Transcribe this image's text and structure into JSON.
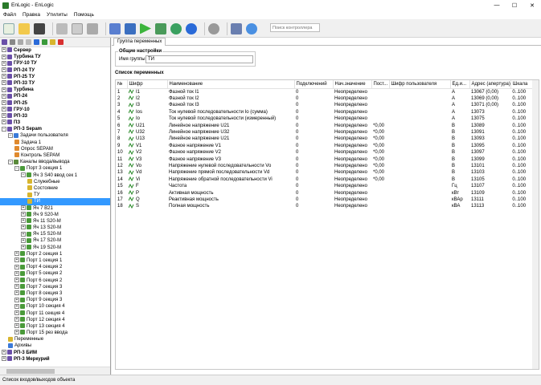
{
  "window": {
    "title": "EnLogic - EnLogic",
    "buttons": [
      "—",
      "☐",
      "✕"
    ]
  },
  "menu": [
    "Файл",
    "Правка",
    "Утилиты",
    "Помощь"
  ],
  "search": {
    "placeholder": "Поиск контроллера"
  },
  "tree": [
    {
      "label": "Сервер",
      "lvl": 0,
      "exp": "+",
      "bold": true,
      "icon": "#6a4fa8"
    },
    {
      "label": "Турбина ТУ",
      "lvl": 0,
      "exp": "+",
      "bold": true,
      "icon": "#6a4fa8"
    },
    {
      "label": "ГРУ-10 ТУ",
      "lvl": 0,
      "exp": "+",
      "bold": true,
      "icon": "#6a4fa8"
    },
    {
      "label": "РП-24 ТУ",
      "lvl": 0,
      "exp": "+",
      "bold": true,
      "icon": "#6a4fa8"
    },
    {
      "label": "РП-25 ТУ",
      "lvl": 0,
      "exp": "+",
      "bold": true,
      "icon": "#6a4fa8"
    },
    {
      "label": "РП-33 ТУ",
      "lvl": 0,
      "exp": "+",
      "bold": true,
      "icon": "#6a4fa8"
    },
    {
      "label": "Турбина",
      "lvl": 0,
      "exp": "+",
      "bold": true,
      "icon": "#6a4fa8"
    },
    {
      "label": "РП-24",
      "lvl": 0,
      "exp": "+",
      "bold": true,
      "icon": "#6a4fa8"
    },
    {
      "label": "РП-25",
      "lvl": 0,
      "exp": "+",
      "bold": true,
      "icon": "#6a4fa8"
    },
    {
      "label": "ГРУ-10",
      "lvl": 0,
      "exp": "+",
      "bold": true,
      "icon": "#6a4fa8"
    },
    {
      "label": "РП-33",
      "lvl": 0,
      "exp": "+",
      "bold": true,
      "icon": "#6a4fa8"
    },
    {
      "label": "ПЗ",
      "lvl": 0,
      "exp": "+",
      "bold": true,
      "icon": "#6a4fa8"
    },
    {
      "label": "РП-3 Sepam",
      "lvl": 0,
      "exp": "-",
      "bold": true,
      "icon": "#6a4fa8"
    },
    {
      "label": "Задачи пользователя",
      "lvl": 1,
      "exp": "-",
      "bold": false,
      "icon": "#3b7ad8"
    },
    {
      "label": "Задача 1",
      "lvl": 2,
      "exp": "",
      "bold": false,
      "icon": "#e08a2e"
    },
    {
      "label": "Опрос SEPAM",
      "lvl": 2,
      "exp": "",
      "bold": false,
      "icon": "#e08a2e"
    },
    {
      "label": "Контроль SEPAM",
      "lvl": 2,
      "exp": "",
      "bold": false,
      "icon": "#e08a2e"
    },
    {
      "label": "Каналы ввода/вывода",
      "lvl": 1,
      "exp": "-",
      "bold": false,
      "icon": "#5a8a3a"
    },
    {
      "label": "Порт 3 секция 1",
      "lvl": 2,
      "exp": "-",
      "bold": false,
      "icon": "#4a9a3a"
    },
    {
      "label": "Яч 3 S40 ввод сек 1",
      "lvl": 3,
      "exp": "-",
      "bold": false,
      "icon": "#4a9a3a"
    },
    {
      "label": "Служебные",
      "lvl": 4,
      "exp": "",
      "bold": false,
      "icon": "#d8b52e"
    },
    {
      "label": "Состояние",
      "lvl": 4,
      "exp": "",
      "bold": false,
      "icon": "#d8b52e"
    },
    {
      "label": "ТУ",
      "lvl": 4,
      "exp": "",
      "bold": false,
      "icon": "#d8b52e"
    },
    {
      "label": "ТИ",
      "lvl": 4,
      "exp": "",
      "bold": false,
      "icon": "#d8b52e",
      "sel": true
    },
    {
      "label": "Яч 7 B21",
      "lvl": 3,
      "exp": "+",
      "bold": false,
      "icon": "#4a9a3a"
    },
    {
      "label": "Яч 9 S20-M",
      "lvl": 3,
      "exp": "+",
      "bold": false,
      "icon": "#4a9a3a"
    },
    {
      "label": "Яч 11 S20-M",
      "lvl": 3,
      "exp": "+",
      "bold": false,
      "icon": "#4a9a3a"
    },
    {
      "label": "Яч 13 S20-M",
      "lvl": 3,
      "exp": "+",
      "bold": false,
      "icon": "#4a9a3a"
    },
    {
      "label": "Яч 15 S20-M",
      "lvl": 3,
      "exp": "+",
      "bold": false,
      "icon": "#4a9a3a"
    },
    {
      "label": "Яч 17 S20-M",
      "lvl": 3,
      "exp": "+",
      "bold": false,
      "icon": "#4a9a3a"
    },
    {
      "label": "Яч 19 S20-M",
      "lvl": 3,
      "exp": "+",
      "bold": false,
      "icon": "#4a9a3a"
    },
    {
      "label": "Порт 2 секция 1",
      "lvl": 2,
      "exp": "+",
      "bold": false,
      "icon": "#4a9a3a"
    },
    {
      "label": "Порт 1 секция 1",
      "lvl": 2,
      "exp": "+",
      "bold": false,
      "icon": "#4a9a3a"
    },
    {
      "label": "Порт 4 секция 2",
      "lvl": 2,
      "exp": "+",
      "bold": false,
      "icon": "#4a9a3a"
    },
    {
      "label": "Порт 5 секция 2",
      "lvl": 2,
      "exp": "+",
      "bold": false,
      "icon": "#4a9a3a"
    },
    {
      "label": "Порт 6 секция 2",
      "lvl": 2,
      "exp": "+",
      "bold": false,
      "icon": "#4a9a3a"
    },
    {
      "label": "Порт 7 секция 3",
      "lvl": 2,
      "exp": "+",
      "bold": false,
      "icon": "#4a9a3a"
    },
    {
      "label": "Порт 8 секция 3",
      "lvl": 2,
      "exp": "+",
      "bold": false,
      "icon": "#4a9a3a"
    },
    {
      "label": "Порт 9 секция 3",
      "lvl": 2,
      "exp": "+",
      "bold": false,
      "icon": "#4a9a3a"
    },
    {
      "label": "Порт 10 секция 4",
      "lvl": 2,
      "exp": "+",
      "bold": false,
      "icon": "#4a9a3a"
    },
    {
      "label": "Порт 11 секция 4",
      "lvl": 2,
      "exp": "+",
      "bold": false,
      "icon": "#4a9a3a"
    },
    {
      "label": "Порт 12 секция 4",
      "lvl": 2,
      "exp": "+",
      "bold": false,
      "icon": "#4a9a3a"
    },
    {
      "label": "Порт 13 секция 4",
      "lvl": 2,
      "exp": "+",
      "bold": false,
      "icon": "#4a9a3a"
    },
    {
      "label": "Порт 15 рез ввода",
      "lvl": 2,
      "exp": "+",
      "bold": false,
      "icon": "#4a9a3a"
    },
    {
      "label": "Переменные",
      "lvl": 1,
      "exp": "",
      "bold": false,
      "icon": "#d8b52e"
    },
    {
      "label": "Архивы",
      "lvl": 1,
      "exp": "",
      "bold": false,
      "icon": "#3b7ad8"
    },
    {
      "label": "РП-3 БИМ",
      "lvl": 0,
      "exp": "+",
      "bold": true,
      "icon": "#6a4fa8"
    },
    {
      "label": "РП-3 Меркурий",
      "lvl": 0,
      "exp": "+",
      "bold": true,
      "icon": "#6a4fa8"
    }
  ],
  "tab": "Группа переменных",
  "general": {
    "legend": "Общие настройки",
    "group_label": "Имя группы",
    "group_value": "ТИ"
  },
  "list_title": "Список переменных",
  "columns": [
    "№",
    "Шифр",
    "Наименование",
    "Подключений",
    "Нач.значение",
    "Пост...",
    "Шифр пользователя",
    "Ед.и...",
    "Адрес (апертура)",
    "Шкала"
  ],
  "rows": [
    [
      "1",
      "I1",
      "Фазной ток I1",
      "0",
      "Неопределено",
      "",
      "",
      "A",
      "13067 (0,00)",
      "0..100"
    ],
    [
      "2",
      "I2",
      "Фазной ток I2",
      "0",
      "Неопределено",
      "",
      "",
      "A",
      "13069 (0,00)",
      "0..100"
    ],
    [
      "3",
      "I3",
      "Фазной ток I3",
      "0",
      "Неопределено",
      "",
      "",
      "A",
      "13071 (0,00)",
      "0..100"
    ],
    [
      "4",
      "Ios",
      "Ток нулевой последовательности Io (сумма)",
      "0",
      "Неопределено",
      "",
      "",
      "A",
      "13073",
      "0..100"
    ],
    [
      "5",
      "Io",
      "Ток нулевой последовательности (измеренный)",
      "0",
      "Неопределено",
      "",
      "",
      "A",
      "13075",
      "0..100"
    ],
    [
      "6",
      "U21",
      "Линейное напряжение U21",
      "0",
      "Неопределено",
      "*0,00",
      "",
      "B",
      "13089",
      "0..100"
    ],
    [
      "7",
      "U32",
      "Линейное напряжение U32",
      "0",
      "Неопределено",
      "*0,00",
      "",
      "B",
      "13091",
      "0..100"
    ],
    [
      "8",
      "U13",
      "Линейное напряжение U21",
      "0",
      "Неопределено",
      "*0,00",
      "",
      "B",
      "13093",
      "0..100"
    ],
    [
      "9",
      "V1",
      "Фазное напряжение V1",
      "0",
      "Неопределено",
      "*0,00",
      "",
      "B",
      "13095",
      "0..100"
    ],
    [
      "10",
      "V2",
      "Фазное напряжение V2",
      "0",
      "Неопределено",
      "*0,00",
      "",
      "B",
      "13097",
      "0..100"
    ],
    [
      "11",
      "V3",
      "Фазное напряжение V3",
      "0",
      "Неопределено",
      "*0,00",
      "",
      "B",
      "13099",
      "0..100"
    ],
    [
      "12",
      "Vo",
      "Напряжение нулевой последовательности Vo",
      "0",
      "Неопределено",
      "*0,00",
      "",
      "B",
      "13101",
      "0..100"
    ],
    [
      "13",
      "Vd",
      "Напряжение прямой последовательности Vd",
      "0",
      "Неопределено",
      "*0,00",
      "",
      "B",
      "13103",
      "0..100"
    ],
    [
      "14",
      "Vi",
      "Напряжение обратной последовательности Vi",
      "0",
      "Неопределено",
      "*0,00",
      "",
      "B",
      "13105",
      "0..100"
    ],
    [
      "15",
      "F",
      "Частота",
      "0",
      "Неопределено",
      "",
      "",
      "Гц",
      "13107",
      "0..100"
    ],
    [
      "16",
      "P",
      "Активная мощность",
      "0",
      "Неопределено",
      "",
      "",
      "кВт",
      "13109",
      "0..100"
    ],
    [
      "17",
      "Q",
      "Реактивная мощность",
      "0",
      "Неопределено",
      "",
      "",
      "кВАр",
      "13111",
      "0..100"
    ],
    [
      "18",
      "S",
      "Полная мощность",
      "0",
      "Неопределено",
      "",
      "",
      "кВА",
      "13113",
      "0..100"
    ]
  ],
  "status": "Список входов/выходов объекта"
}
